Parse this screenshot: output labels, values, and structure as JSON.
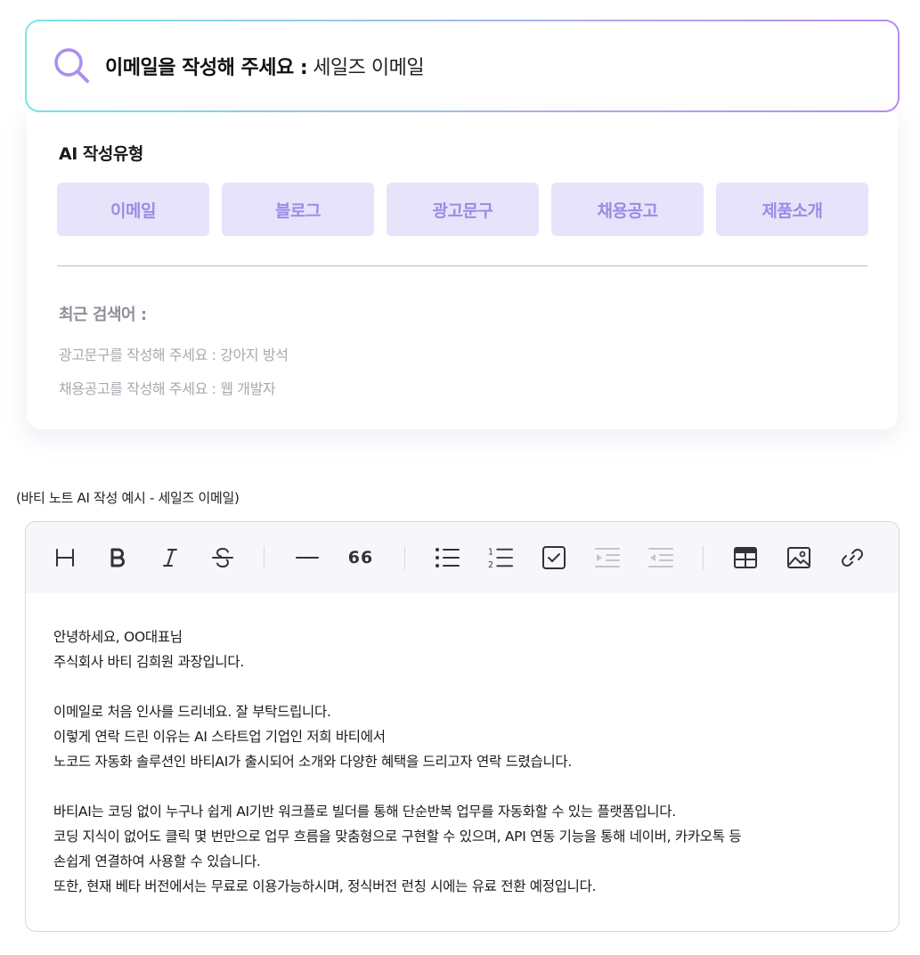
{
  "search": {
    "prompt": "이메일을 작성해 주세요 :",
    "value": "세일즈 이메일"
  },
  "panel": {
    "title": "AI 작성유형",
    "types": [
      "이메일",
      "블로그",
      "광고문구",
      "채용공고",
      "제품소개"
    ],
    "recent_title": "최근 검색어 :",
    "recent": [
      "광고문구를 작성해 주세요 : 강아지 방석",
      "채용공고를 작성해 주세요 : 웹 개발자"
    ]
  },
  "caption": "(바티 노트 AI 작성 예시 - 세일즈 이메일)",
  "editor": {
    "toolbar": {
      "quote_glyph": "66"
    },
    "paragraphs": [
      [
        "안녕하세요, OO대표님",
        "주식회사 바티 김희원 과장입니다."
      ],
      [
        "이메일로 처음 인사를 드리네요. 잘 부탁드립니다.",
        "이렇게 연락 드린 이유는 AI 스타트업 기업인 저희 바티에서",
        "노코드 자동화 솔루션인 바티AI가 출시되어 소개와 다양한 혜택을 드리고자 연락 드렸습니다."
      ],
      [
        "바티AI는 코딩 없이 누구나 쉽게 AI기반 워크플로 빌더를 통해 단순반복 업무를 자동화할 수 있는 플랫폼입니다.",
        "코딩 지식이 없어도 클릭 몇 번만으로 업무 흐름을 맞춤형으로 구현할 수 있으며, API 연동 기능을 통해 네이버, 카카오톡 등",
        "손쉽게 연결하여 사용할 수 있습니다.",
        "또한, 현재 베타 버전에서는 무료로 이용가능하시며, 정식버전 런칭 시에는 유료 전환 예정입니다."
      ]
    ]
  },
  "colors": {
    "accent": "#9b8ce4",
    "chip_bg": "#e7e3fb",
    "border_gradient": [
      "#7ae7e2",
      "#b98cf2"
    ]
  }
}
